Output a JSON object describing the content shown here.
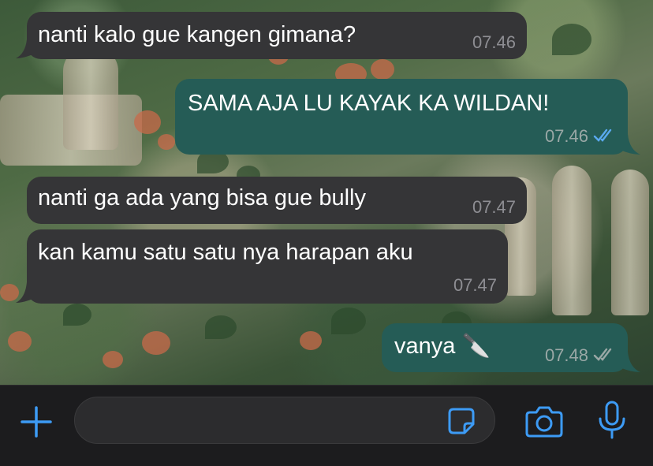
{
  "messages": [
    {
      "direction": "in",
      "text": "nanti kalo gue kangen gimana?",
      "time": "07.46"
    },
    {
      "direction": "out",
      "text": "SAMA AJA LU KAYAK KA WILDAN!",
      "time": "07.46",
      "status": "read"
    },
    {
      "direction": "in",
      "text": "nanti ga ada yang bisa gue bully",
      "time": "07.47"
    },
    {
      "direction": "in",
      "text": "kan kamu satu satu nya harapan aku",
      "time": "07.47"
    },
    {
      "direction": "out",
      "text": "vanya 🔪",
      "time": "07.48",
      "status": "delivered"
    }
  ],
  "input_bar": {
    "attach_icon": "plus-icon",
    "sticker_icon": "sticker-icon",
    "camera_icon": "camera-icon",
    "mic_icon": "microphone-icon",
    "message_value": ""
  },
  "colors": {
    "incoming_bubble": "#353537",
    "outgoing_bubble": "#255c56",
    "accent": "#3d9bf5",
    "read_ticks": "#5aa9f0",
    "delivered_ticks": "#9aa8a6"
  }
}
